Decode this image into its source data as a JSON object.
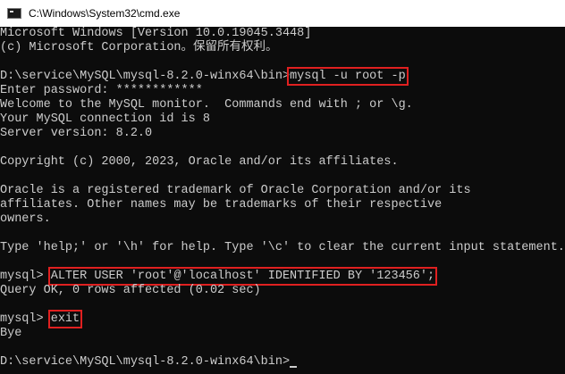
{
  "window": {
    "title": "C:\\Windows\\System32\\cmd.exe"
  },
  "terminal": {
    "banner1": "Microsoft Windows [Version 10.0.19045.3448]",
    "banner2": "(c) Microsoft Corporation。保留所有权利。",
    "prompt_path": "D:\\service\\MySQL\\mysql-8.2.0-winx64\\bin>",
    "command1": "mysql -u root -p",
    "password_line": "Enter password: ************",
    "welcome1": "Welcome to the MySQL monitor.  Commands end with ; or \\g.",
    "welcome2": "Your MySQL connection id is 8",
    "welcome3": "Server version: 8.2.0",
    "copyright": "Copyright (c) 2000, 2023, Oracle and/or its affiliates.",
    "trademark1": "Oracle is a registered trademark of Oracle Corporation and/or its",
    "trademark2": "affiliates. Other names may be trademarks of their respective",
    "trademark3": "owners.",
    "help_line": "Type 'help;' or '\\h' for help. Type '\\c' to clear the current input statement.",
    "mysql_prompt": "mysql> ",
    "command2": "ALTER USER 'root'@'localhost' IDENTIFIED BY '123456';",
    "result_line": "Query OK, 0 rows affected (0.02 sec)",
    "command3": "exit",
    "bye_line": "Bye",
    "final_prompt": "D:\\service\\MySQL\\mysql-8.2.0-winx64\\bin>"
  },
  "colors": {
    "background": "#0c0c0c",
    "text": "#cccccc",
    "highlight_box": "#e02020",
    "titlebar": "#ffffff"
  },
  "icons": {
    "app": "cmd-console-icon"
  }
}
